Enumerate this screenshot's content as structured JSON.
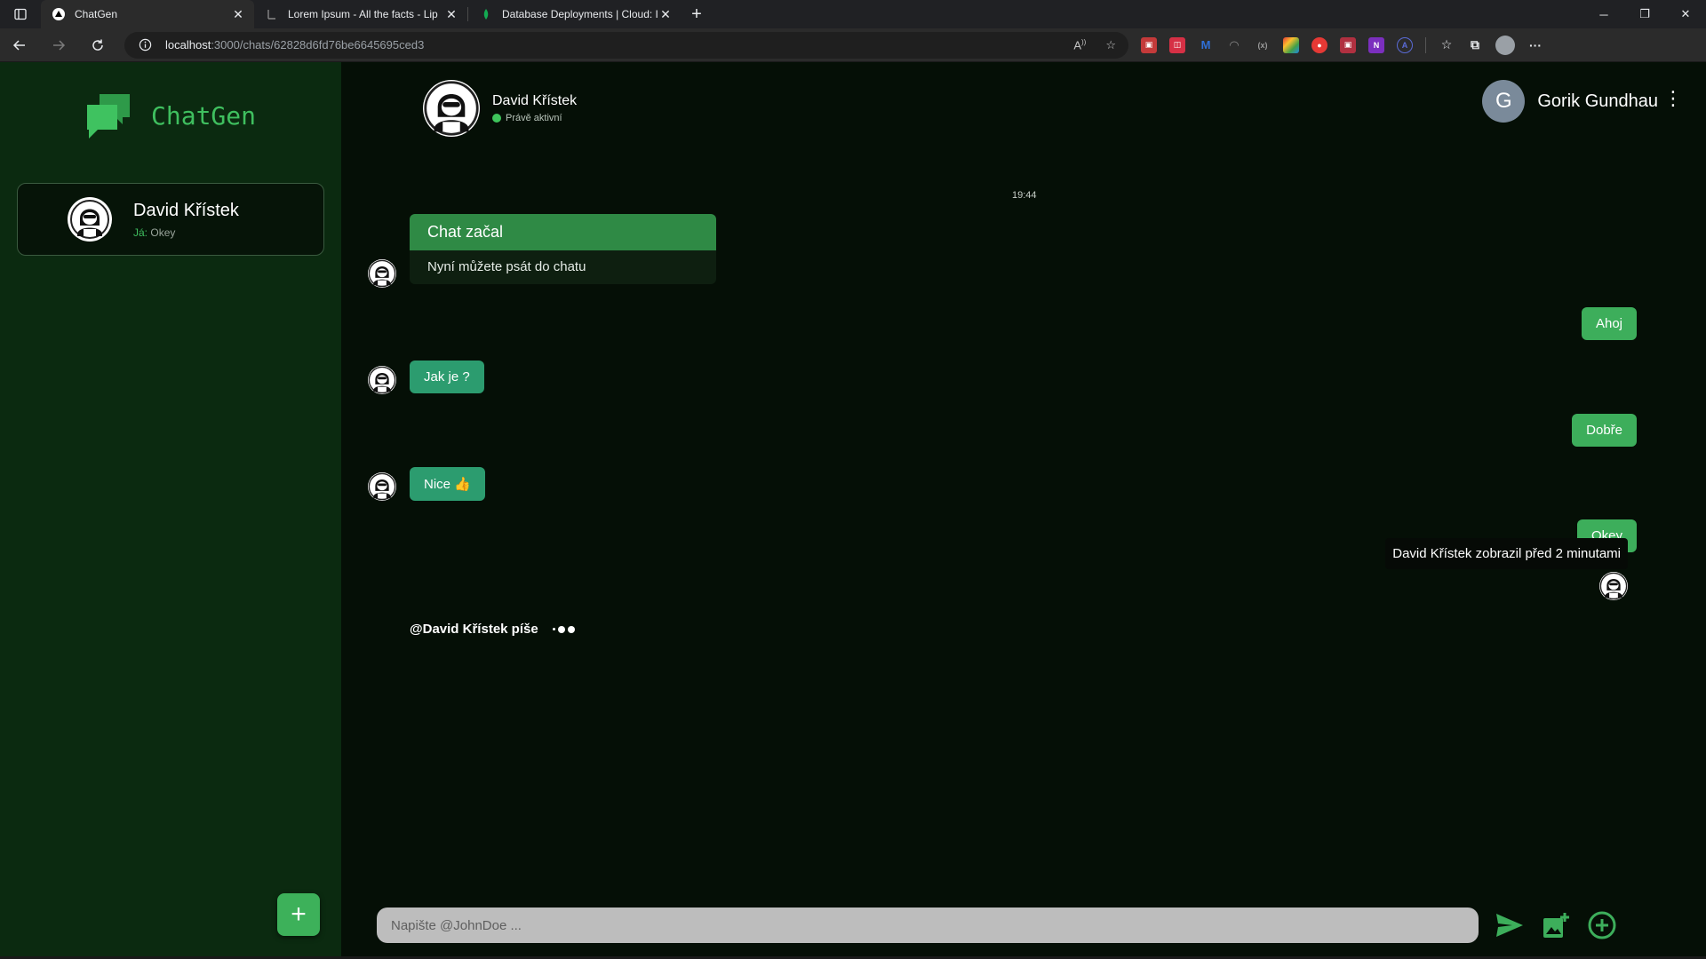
{
  "browser": {
    "tabs": [
      {
        "title": "ChatGen",
        "active": true
      },
      {
        "title": "Lorem Ipsum - All the facts - Lip",
        "active": false
      },
      {
        "title": "Database Deployments | Cloud: I",
        "active": false
      }
    ],
    "url_host": "localhost",
    "url_path": ":3000/chats/62828d6fd76be6645695ced3",
    "icons": [
      "sidebar-icon",
      "back-icon",
      "forward-icon",
      "reload-icon",
      "info-icon",
      "read-aloud-icon",
      "favorite-add-icon",
      "favorites-icon",
      "collections-icon",
      "profile-icon",
      "more-icon"
    ]
  },
  "app": {
    "brand": "ChatGen",
    "conversation": {
      "name": "David Křístek",
      "last_prefix": "Já:",
      "last_message": "Okey"
    },
    "new_chat_label": "+",
    "header": {
      "contact_name": "David Křístek",
      "contact_status": "Právě aktivní",
      "me_initial": "G",
      "me_name": "Gorik Gundhau",
      "menu_glyph": "⋮"
    },
    "timestamp": "19:44",
    "system_card": {
      "title": "Chat začal",
      "body": "Nyní můžete psát do chatu"
    },
    "messages": [
      {
        "dir": "out",
        "text": "Ahoj"
      },
      {
        "dir": "in",
        "text": "Jak je ?"
      },
      {
        "dir": "out",
        "text": "Dobře"
      },
      {
        "dir": "in",
        "text": "Nice 👍"
      },
      {
        "dir": "out",
        "text": "Okey"
      }
    ],
    "seen_tooltip": "David Křístek zobrazil před 2 minutami",
    "typing_text": "@David Křístek píše",
    "composer_placeholder": "Napište @JohnDoe ...",
    "colors": {
      "sidebar_bg": "#0b2a10",
      "main_bg": "#050f06",
      "accent": "#3dae5b",
      "incoming_bubble": "#2c9c6f",
      "system_header": "#2f8a45"
    }
  }
}
